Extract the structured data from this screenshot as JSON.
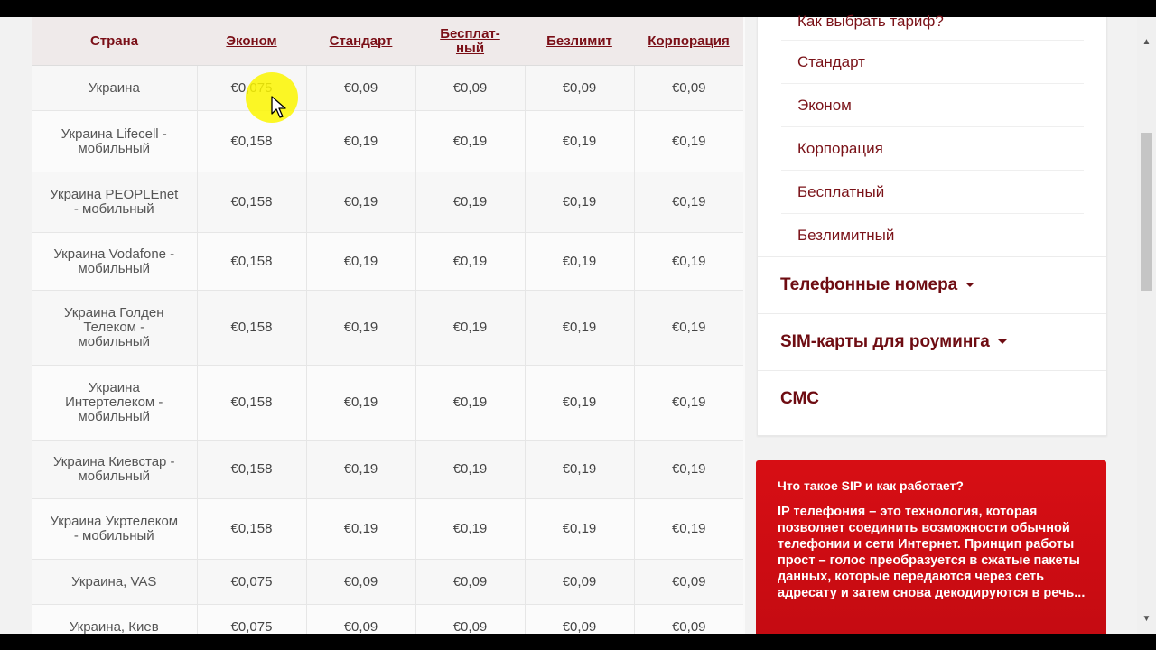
{
  "table": {
    "headers": [
      "Страна",
      "Эконом",
      "Стандарт",
      "Бесплат-\nный",
      "Безлимит",
      "Корпорация"
    ],
    "rows": [
      {
        "country": "Украина",
        "values": [
          "€0,075",
          "€0,09",
          "€0,09",
          "€0,09",
          "€0,09"
        ]
      },
      {
        "country": "Украина Lifecell -\nмобильный",
        "values": [
          "€0,158",
          "€0,19",
          "€0,19",
          "€0,19",
          "€0,19"
        ]
      },
      {
        "country": "Украина PEOPLEnet\n- мобильный",
        "values": [
          "€0,158",
          "€0,19",
          "€0,19",
          "€0,19",
          "€0,19"
        ]
      },
      {
        "country": "Украина Vodafone -\nмобильный",
        "values": [
          "€0,158",
          "€0,19",
          "€0,19",
          "€0,19",
          "€0,19"
        ]
      },
      {
        "country": "Украина Голден\nТелеком -\nмобильный",
        "values": [
          "€0,158",
          "€0,19",
          "€0,19",
          "€0,19",
          "€0,19"
        ]
      },
      {
        "country": "Украина\nИнтертелеком -\nмобильный",
        "values": [
          "€0,158",
          "€0,19",
          "€0,19",
          "€0,19",
          "€0,19"
        ]
      },
      {
        "country": "Украина Киевстар -\nмобильный",
        "values": [
          "€0,158",
          "€0,19",
          "€0,19",
          "€0,19",
          "€0,19"
        ]
      },
      {
        "country": "Украина Укртелеком\n- мобильный",
        "values": [
          "€0,158",
          "€0,19",
          "€0,19",
          "€0,19",
          "€0,19"
        ]
      },
      {
        "country": "Украина, VAS",
        "values": [
          "€0,075",
          "€0,09",
          "€0,09",
          "€0,09",
          "€0,09"
        ]
      },
      {
        "country": "Украина, Киев",
        "values": [
          "€0,075",
          "€0,09",
          "€0,09",
          "€0,09",
          "€0,09"
        ]
      }
    ]
  },
  "sidebar": {
    "tariffs": [
      "Как выбрать тариф?",
      "Стандарт",
      "Эконом",
      "Корпорация",
      "Бесплатный",
      "Безлимитный"
    ],
    "sections": [
      {
        "label": "Телефонные номера",
        "caret": true
      },
      {
        "label": "SIM-карты для роуминга",
        "caret": true
      },
      {
        "label": "СМС",
        "caret": false
      }
    ]
  },
  "sip_box": {
    "title": "Что такое SIP и как работает?",
    "text": "IP телефония – это технология, которая позволяет соединить возможности обычной телефонии и сети Интернет. Принцип работы прост – голос преобразуется в сжатые пакеты данных, которые передаются через сеть адресату и затем снова декодируются в речь...",
    "color": "#d70e14"
  },
  "colors": {
    "accent": "#7a0f17",
    "highlight": "#fcf600"
  },
  "icons": {
    "scroll_up": "▲",
    "scroll_down": "▼"
  }
}
